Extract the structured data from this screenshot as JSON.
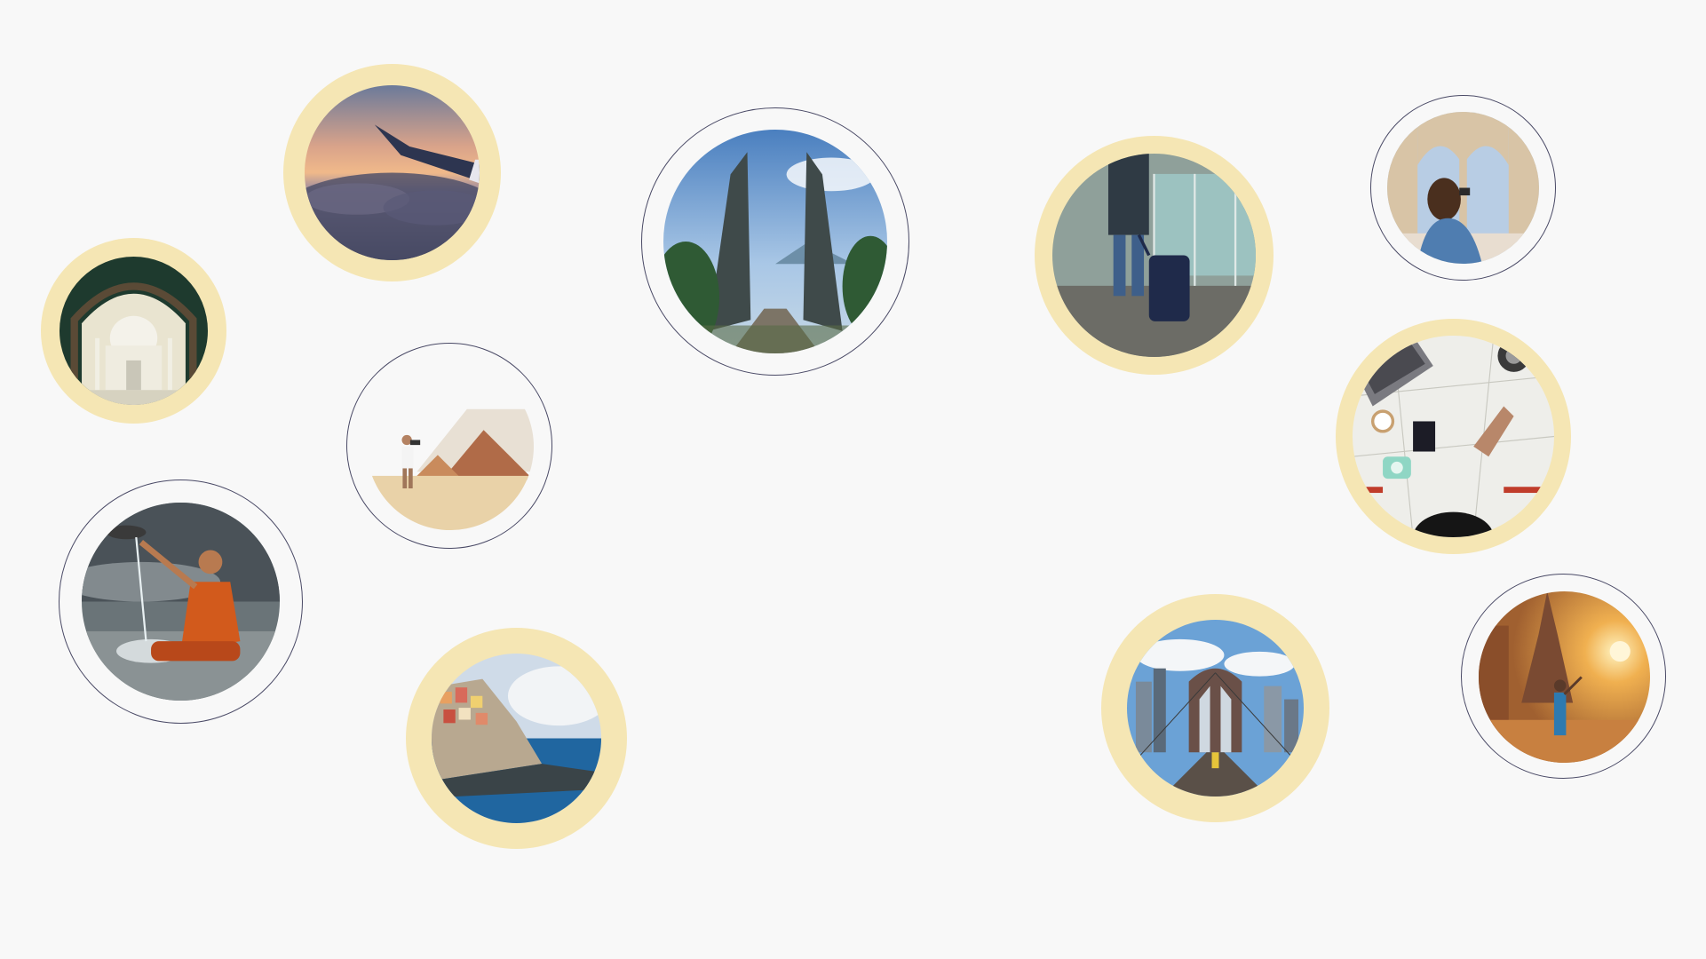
{
  "page": {
    "background": "#f8f8f8"
  },
  "colors": {
    "gold_ring": "#f5e6b4",
    "outline_ring": "#4a4a66"
  },
  "photos": [
    {
      "name": "airplane-wing-over-clouds",
      "style": "gold"
    },
    {
      "name": "taj-mahal-through-arch",
      "style": "gold"
    },
    {
      "name": "bali-temple-gate",
      "style": "outline"
    },
    {
      "name": "traveler-with-suitcase",
      "style": "gold"
    },
    {
      "name": "photographer-in-ruins",
      "style": "outline"
    },
    {
      "name": "map-passport-camera-flatlay",
      "style": "gold"
    },
    {
      "name": "photographer-at-pyramids",
      "style": "outline"
    },
    {
      "name": "monk-pouring-water",
      "style": "outline"
    },
    {
      "name": "cinque-terre-cliffside-village",
      "style": "gold"
    },
    {
      "name": "brooklyn-bridge-walkway",
      "style": "gold"
    },
    {
      "name": "temple-at-sunset-traveler",
      "style": "outline"
    }
  ]
}
